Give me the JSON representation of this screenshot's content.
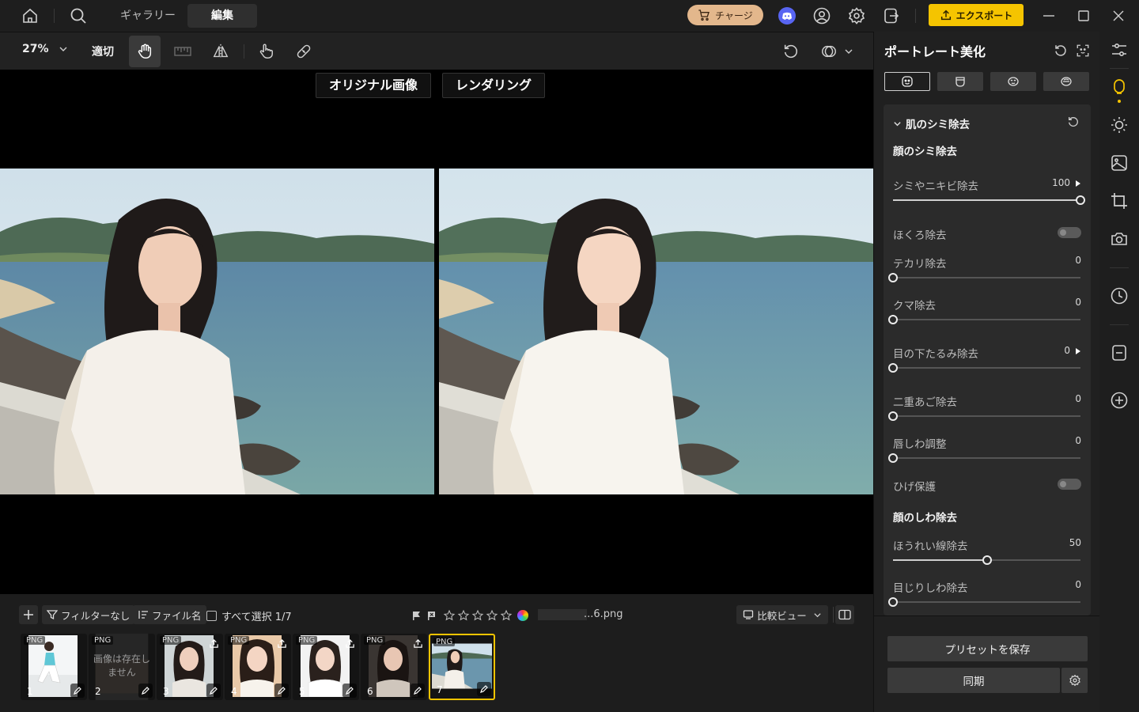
{
  "titlebar": {
    "tabs": [
      {
        "label": "ギャラリー",
        "active": false
      },
      {
        "label": "編集",
        "active": true
      }
    ],
    "charge_label": "チャージ",
    "export_label": "エクスポート"
  },
  "toolbar": {
    "zoom": "27%",
    "fit_label": "適切"
  },
  "canvas": {
    "original_label": "オリジナル画像",
    "render_label": "レンダリング"
  },
  "strip": {
    "filter_label": "フィルターなし",
    "sort_label": "ファイル名",
    "select_all_label": "すべて選択 1/7",
    "filename": "...6.png",
    "view_label": "比較ビュー",
    "thumbs": [
      {
        "badge": "PNG",
        "num": "1",
        "missing": false,
        "selected": false
      },
      {
        "badge": "PNG",
        "num": "2",
        "missing": true,
        "missing_text": "画像は存在しません",
        "selected": false
      },
      {
        "badge": "PNG",
        "num": "3",
        "missing": false,
        "selected": false
      },
      {
        "badge": "PNG",
        "num": "4",
        "missing": false,
        "selected": false
      },
      {
        "badge": "PNG",
        "num": "5",
        "missing": false,
        "selected": false
      },
      {
        "badge": "PNG",
        "num": "6",
        "missing": false,
        "selected": false
      },
      {
        "badge": "PNG",
        "num": "7",
        "missing": false,
        "selected": true
      }
    ]
  },
  "panel": {
    "title": "ポートレート美化",
    "section_title": "肌のシミ除去",
    "group1_title": "顔のシミ除去",
    "group2_title": "顔のしわ除去",
    "controls": [
      {
        "label": "シミやニキビ除去",
        "value": "100",
        "fraction": 1.0,
        "type": "slider",
        "arrow": true
      },
      {
        "label": "ほくろ除去",
        "type": "toggle"
      },
      {
        "label": "テカリ除去",
        "value": "0",
        "fraction": 0.0,
        "type": "slider"
      },
      {
        "label": "クマ除去",
        "value": "0",
        "fraction": 0.0,
        "type": "slider"
      },
      {
        "label": "目の下たるみ除去",
        "value": "0",
        "fraction": 0.0,
        "type": "slider",
        "arrow": true
      },
      {
        "label": "二重あご除去",
        "value": "0",
        "fraction": 0.0,
        "type": "slider"
      },
      {
        "label": "唇しわ調整",
        "value": "0",
        "fraction": 0.0,
        "type": "slider"
      },
      {
        "label": "ひげ保護",
        "type": "toggle"
      },
      {
        "label": "ほうれい線除去",
        "value": "50",
        "fraction": 0.5,
        "type": "slider"
      },
      {
        "label": "目じりしわ除去",
        "value": "0",
        "fraction": 0.0,
        "type": "slider"
      }
    ],
    "save_preset_label": "プリセットを保存",
    "sync_label": "同期"
  },
  "colors": {
    "accent": "#f5c400",
    "charge_bg": "#e3b78c",
    "discord": "#5865f2"
  }
}
